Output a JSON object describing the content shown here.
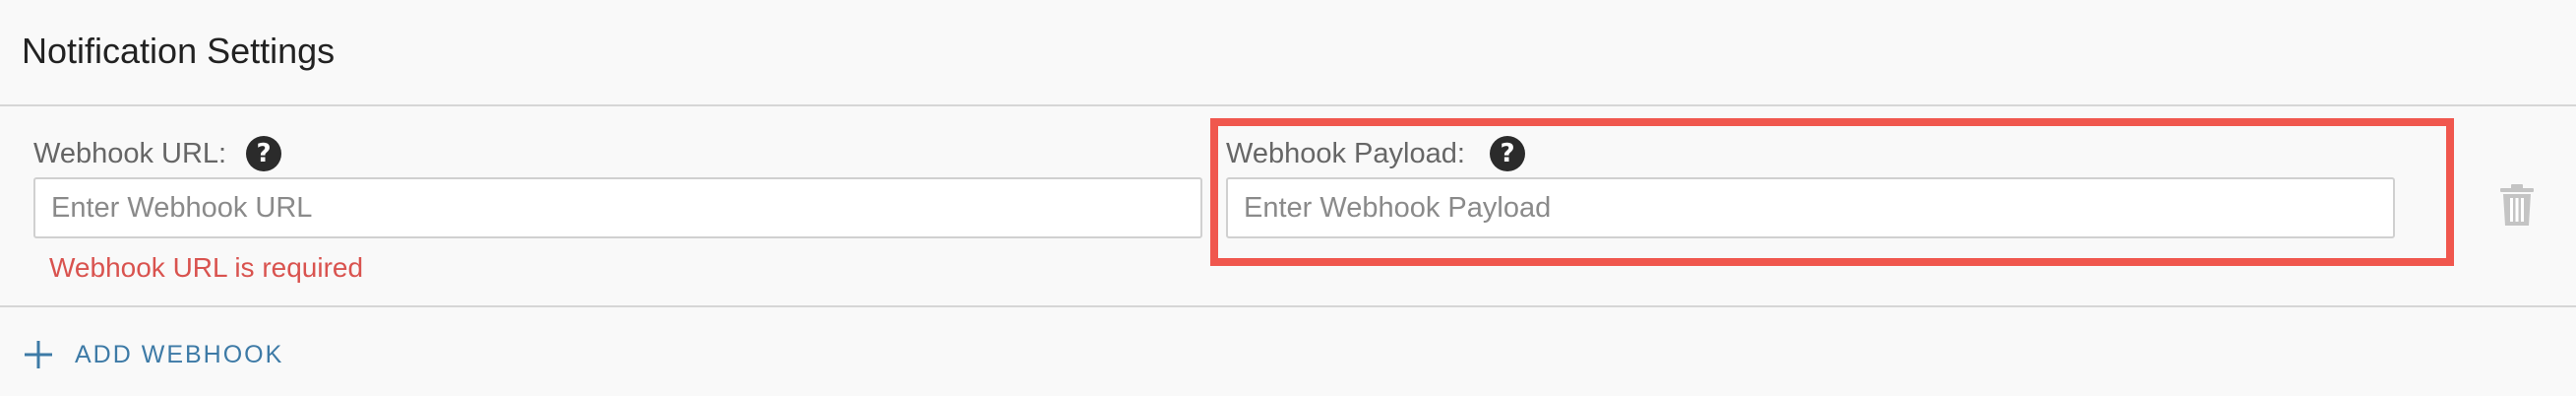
{
  "header": {
    "title": "Notification Settings"
  },
  "webhook": {
    "url_label": "Webhook URL:",
    "url_value": "",
    "url_placeholder": "Enter Webhook URL",
    "url_error": "Webhook URL is required",
    "payload_label": "Webhook Payload:",
    "payload_value": "",
    "payload_placeholder": "Enter Webhook Payload",
    "help_glyph": "?",
    "delete_icon": "trash-icon"
  },
  "actions": {
    "add_label": "ADD WEBHOOK",
    "add_icon": "plus-icon"
  },
  "colors": {
    "error": "#d9534f",
    "link": "#3d7aa6",
    "highlight": "#f0574e"
  }
}
